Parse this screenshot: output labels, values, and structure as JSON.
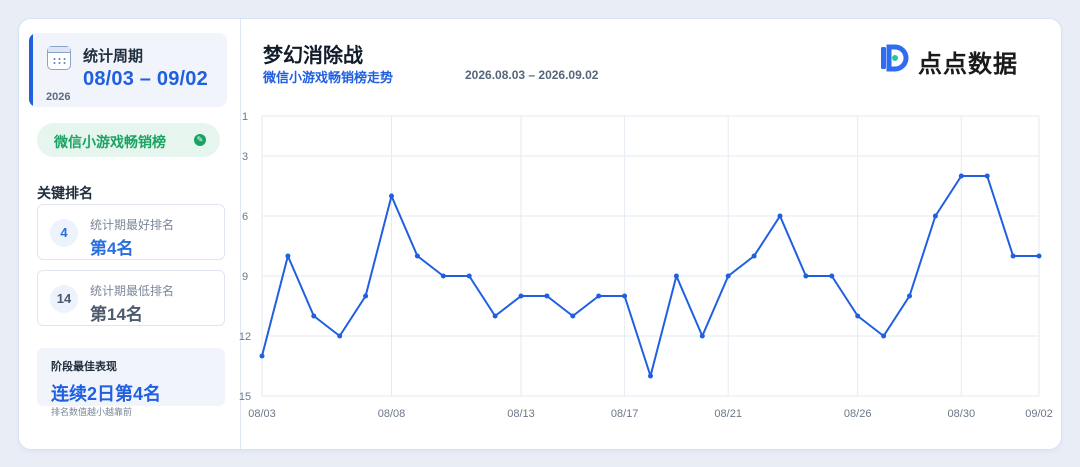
{
  "sidebar": {
    "period_label": "统计周期",
    "period_range": "08/03 – 09/02",
    "period_year": "2026",
    "list_tag": "微信小游戏畅销榜",
    "key_ranks_title": "关键排名",
    "best_rank": {
      "number": "4",
      "label": "统计期最好排名",
      "value": "第4名"
    },
    "worst_rank": {
      "number": "14",
      "label": "统计期最低排名",
      "value": "第14名"
    },
    "best_streak": {
      "title": "阶段最佳表现",
      "value": "连续2日第4名"
    },
    "note": "排名数值越小越靠前",
    "colors": {
      "accent": "#1f5fe0",
      "tag_green": "#19a463",
      "best_color": "#2a6fdf",
      "worst_color": "#4d5a6c"
    }
  },
  "header": {
    "title": "梦幻消除战",
    "subtitle": "微信小游戏畅销榜走势",
    "date_range": "2026.08.03 – 2026.09.02"
  },
  "logo": {
    "text": "点点数据",
    "icon": "diandian-logo-icon"
  },
  "chart_data": {
    "type": "line",
    "title": "",
    "xlabel": "",
    "ylabel": "",
    "y_inverted": true,
    "ylim": [
      1,
      15
    ],
    "yticks": [
      1,
      3,
      6,
      9,
      12,
      15
    ],
    "xticks": [
      "08/03",
      "08/08",
      "08/13",
      "08/17",
      "08/21",
      "08/26",
      "08/30",
      "09/02"
    ],
    "grid": true,
    "line_color": "#1f5fe0",
    "x": [
      "08/03",
      "08/04",
      "08/05",
      "08/06",
      "08/07",
      "08/08",
      "08/09",
      "08/10",
      "08/11",
      "08/12",
      "08/13",
      "08/14",
      "08/15",
      "08/16",
      "08/17",
      "08/18",
      "08/19",
      "08/20",
      "08/21",
      "08/22",
      "08/23",
      "08/24",
      "08/25",
      "08/26",
      "08/27",
      "08/28",
      "08/29",
      "08/30",
      "08/31",
      "09/01",
      "09/02"
    ],
    "series": [
      {
        "values": [
          13,
          8,
          11,
          12,
          10,
          5,
          8,
          9,
          9,
          11,
          10,
          10,
          11,
          10,
          10,
          14,
          9,
          12,
          9,
          8,
          6,
          9,
          9,
          11,
          12,
          10,
          6,
          4,
          4,
          8,
          8
        ]
      }
    ]
  }
}
